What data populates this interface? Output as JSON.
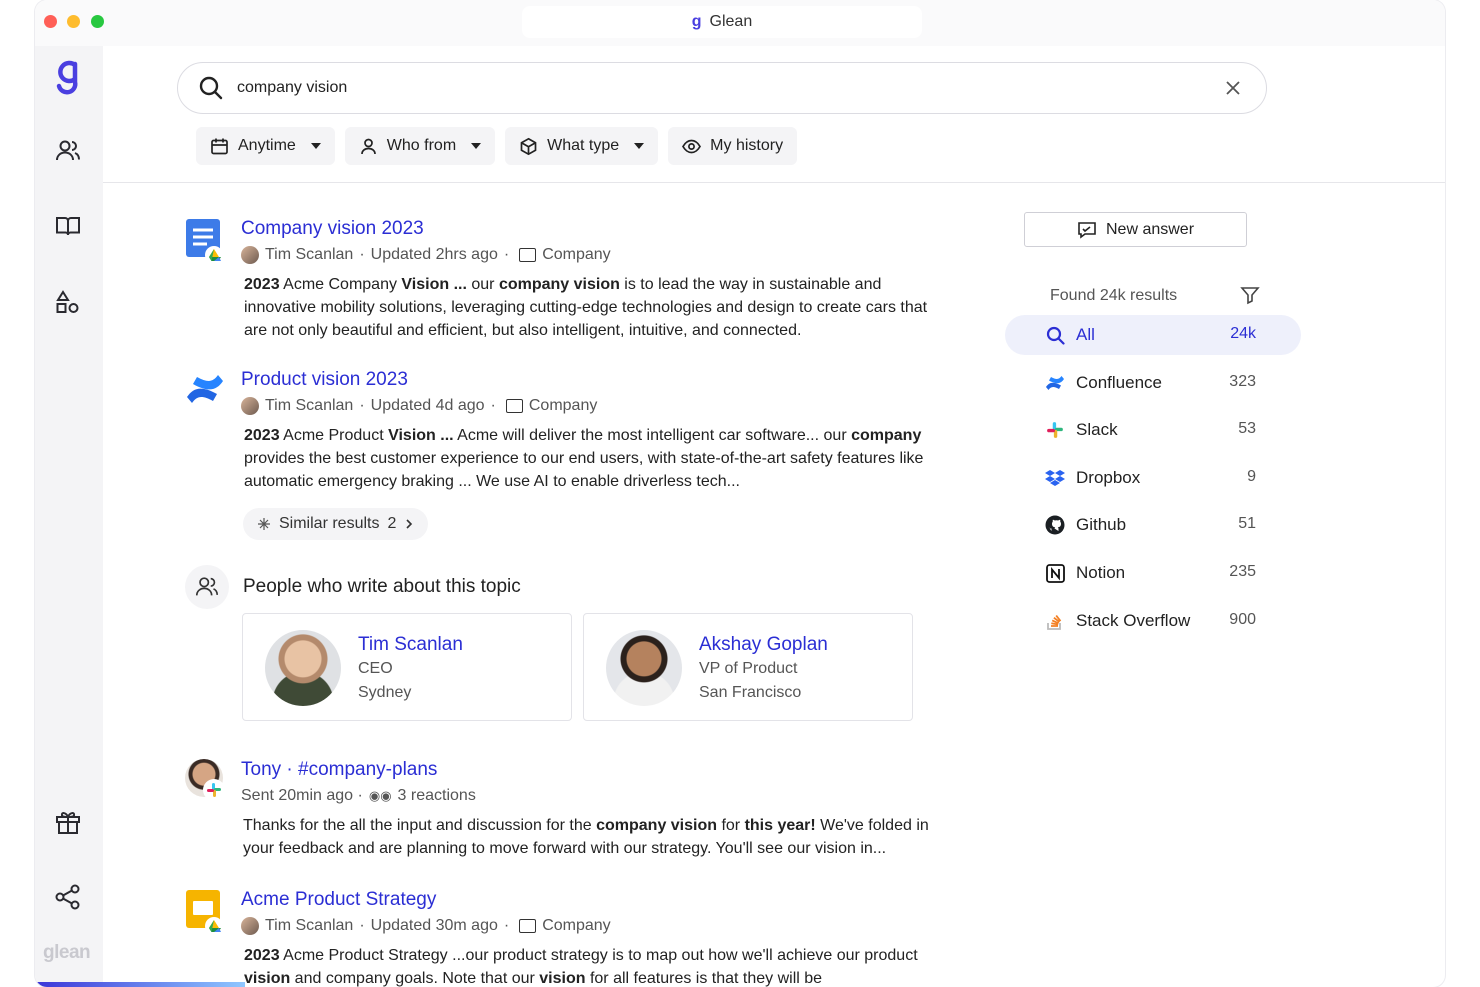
{
  "window": {
    "title": "Glean"
  },
  "sidebar": {
    "brand_word": "glean",
    "items": [
      {
        "name": "people",
        "icon": "people-icon"
      },
      {
        "name": "knowledge",
        "icon": "book-icon"
      },
      {
        "name": "apps",
        "icon": "shapes-icon"
      },
      {
        "name": "whats-new",
        "icon": "gift-icon"
      },
      {
        "name": "share",
        "icon": "share-icon"
      }
    ]
  },
  "search": {
    "query": "company vision",
    "placeholder": ""
  },
  "filters": [
    {
      "label": "Anytime",
      "icon": "calendar-icon",
      "dropdown": true
    },
    {
      "label": "Who from",
      "icon": "person-icon",
      "dropdown": true
    },
    {
      "label": "What type",
      "icon": "cube-icon",
      "dropdown": true
    },
    {
      "label": "My history",
      "icon": "eye-icon",
      "dropdown": false
    }
  ],
  "results": [
    {
      "title": "Company vision 2023",
      "author": "Tim Scanlan",
      "updated": "Updated 2hrs ago",
      "folder": "Company",
      "source_icon": "google-docs-icon",
      "snippet": [
        [
          {
            "t": "2023",
            "b": true
          },
          {
            "t": " Acme Company "
          },
          {
            "t": "Vision ...",
            "b": true
          },
          {
            "t": " our "
          },
          {
            "t": "company vision",
            "b": true
          },
          {
            "t": " is to lead the way in sustainable and innovative mobility solutions, leveraging cutting-edge technologies and design to create cars that are not only beautiful and efficient, but also intelligent, intuitive, and connected."
          }
        ]
      ]
    },
    {
      "title": "Product vision 2023",
      "author": "Tim Scanlan",
      "updated": "Updated 4d ago",
      "folder": "Company",
      "source_icon": "confluence-icon",
      "snippet": [
        [
          {
            "t": "2023",
            "b": true
          },
          {
            "t": " Acme Product "
          },
          {
            "t": "Vision ...",
            "b": true
          },
          {
            "t": " Acme will deliver the most intelligent car software... our "
          },
          {
            "t": "company",
            "b": true
          },
          {
            "t": " provides the best customer experience to our end users, with state-of-the-art safety features like automatic emergency braking ... We use AI to enable driverless tech..."
          }
        ]
      ],
      "similar": {
        "label": "Similar results",
        "count": "2"
      }
    },
    {
      "title": "Tony · #company-plans",
      "meta": "Sent 20min ago ·",
      "reactions": "3 reactions",
      "snippet": [
        [
          {
            "t": "Thanks for the all the input and discussion for the "
          },
          {
            "t": "company vision",
            "b": true
          },
          {
            "t": " for "
          },
          {
            "t": "this year!",
            "b": true
          },
          {
            "t": " We've folded in your feedback and are planning to move forward with our strategy. You'll see our vision in..."
          }
        ]
      ]
    },
    {
      "title": "Acme Product Strategy",
      "author": "Tim Scanlan",
      "updated": "Updated 30m ago",
      "folder": "Company",
      "source_icon": "google-slides-icon",
      "snippet": [
        [
          {
            "t": "2023",
            "b": true
          },
          {
            "t": " Acme Product Strategy ...our product strategy is to map out how we'll achieve our product "
          },
          {
            "t": "vision",
            "b": true
          },
          {
            "t": " and company goals. Note that our "
          },
          {
            "t": "vision",
            "b": true
          },
          {
            "t": " for all features is that they will be"
          }
        ]
      ]
    }
  ],
  "people": {
    "heading": "People who write about this topic",
    "cards": [
      {
        "name": "Tim Scanlan",
        "role": "CEO",
        "location": "Sydney"
      },
      {
        "name": "Akshay Goplan",
        "role": "VP of Product",
        "location": "San Francisco"
      }
    ]
  },
  "rightpanel": {
    "new_answer_label": "New answer",
    "found_text": "Found 24k results",
    "sources": [
      {
        "label": "All",
        "count": "24k",
        "icon": "search-icon",
        "active": true
      },
      {
        "label": "Confluence",
        "count": "323",
        "icon": "confluence-icon"
      },
      {
        "label": "Slack",
        "count": "53",
        "icon": "slack-icon"
      },
      {
        "label": "Dropbox",
        "count": "9",
        "icon": "dropbox-icon"
      },
      {
        "label": "Github",
        "count": "51",
        "icon": "github-icon"
      },
      {
        "label": "Notion",
        "count": "235",
        "icon": "notion-icon"
      },
      {
        "label": "Stack Overflow",
        "count": "900",
        "icon": "stackoverflow-icon"
      }
    ]
  },
  "colors": {
    "accent": "#2b2ed4",
    "brand": "#4a3fe0"
  }
}
